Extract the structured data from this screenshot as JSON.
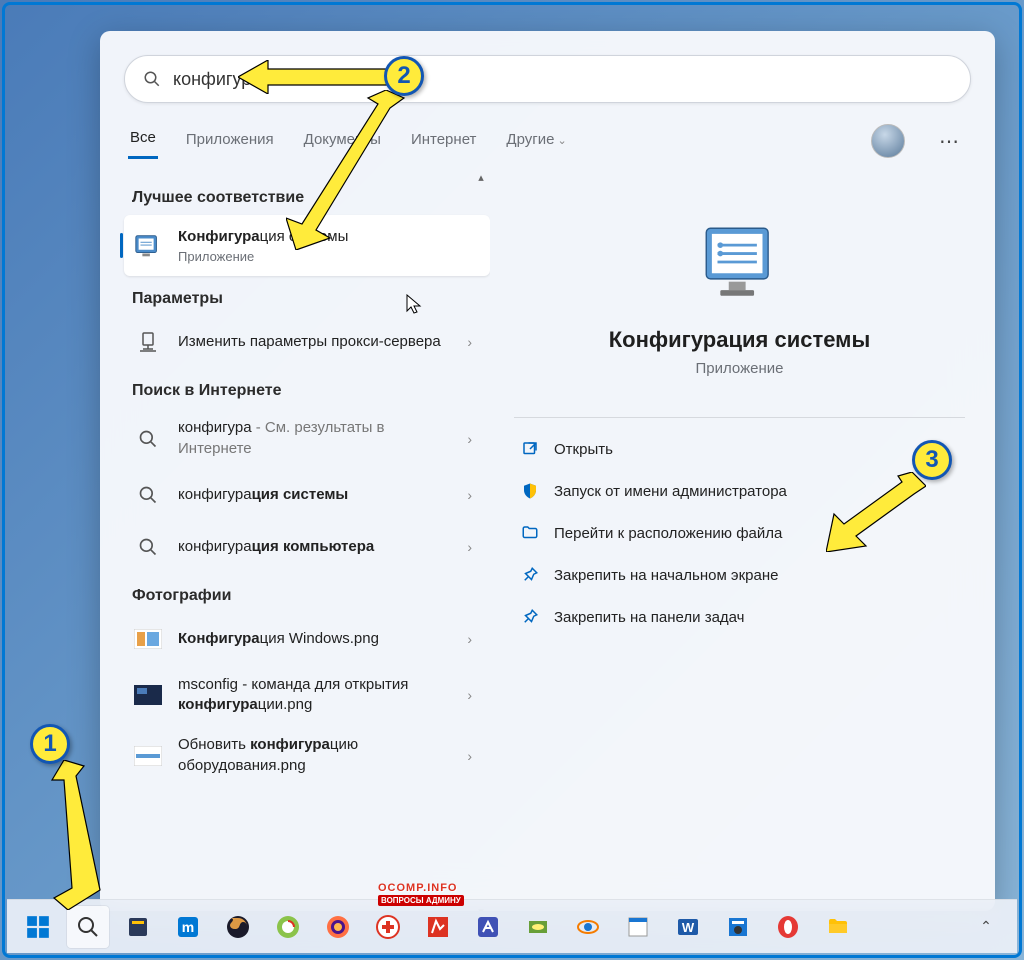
{
  "search": {
    "value": "конфигура"
  },
  "tabs": {
    "all": "Все",
    "apps": "Приложения",
    "docs": "Документы",
    "web": "Интернет",
    "more": "Другие"
  },
  "sections": {
    "best": "Лучшее соответствие",
    "params": "Параметры",
    "web": "Поиск в Интернете",
    "photos": "Фотографии"
  },
  "results": {
    "best_title_pre": "Конфигура",
    "best_title_suf": "ция системы",
    "best_sub": "Приложение",
    "proxy": "Изменить параметры прокси-сервера",
    "websearch_pre": "конфигура",
    "websearch_suf": " - См. результаты в Интернете",
    "web_sys_pre": "конфигура",
    "web_sys_suf": "ция системы",
    "web_comp_pre": "конфигура",
    "web_comp_suf": "ция компьютера",
    "photo1_pre": "Конфигура",
    "photo1_suf": "ция Windows.png",
    "photo2_line1": "msconfig - команда для открытия",
    "photo2_pre": "конфигура",
    "photo2_suf": "ции.png",
    "photo3_line1_pre": "Обновить ",
    "photo3_line1_b": "конфигура",
    "photo3_line1_suf": "цию",
    "photo3_line2": "оборудования.png"
  },
  "detail": {
    "title": "Конфигурация системы",
    "sub": "Приложение",
    "open": "Открыть",
    "admin": "Запуск от имени администратора",
    "location": "Перейти к расположению файла",
    "pin_start": "Закрепить на начальном экране",
    "pin_taskbar": "Закрепить на панели задач"
  },
  "badges": {
    "b1": "1",
    "b2": "2",
    "b3": "3"
  },
  "watermark": {
    "top": "OCOMP.INFO",
    "bot": "ВОПРОСЫ АДМИНУ"
  }
}
